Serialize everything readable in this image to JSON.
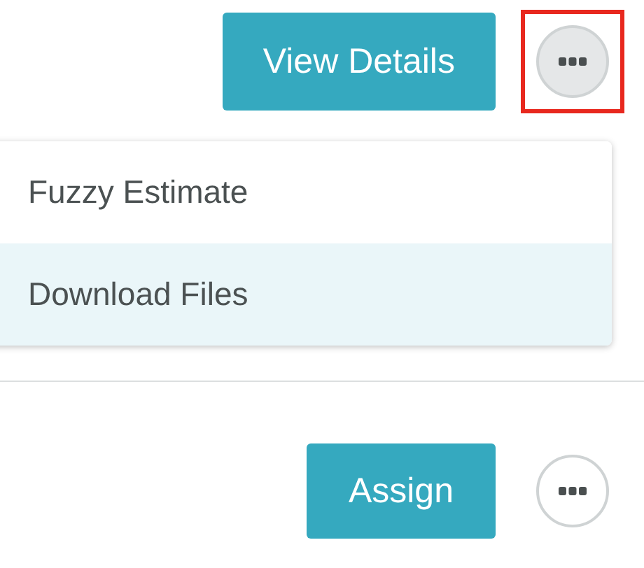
{
  "rows": [
    {
      "action": "View Details",
      "more_highlighted": true,
      "menu": [
        {
          "label": "Fuzzy Estimate",
          "selected": false
        },
        {
          "label": "Download Files",
          "selected": true
        }
      ]
    },
    {
      "action": "Assign",
      "more_highlighted": false
    }
  ]
}
